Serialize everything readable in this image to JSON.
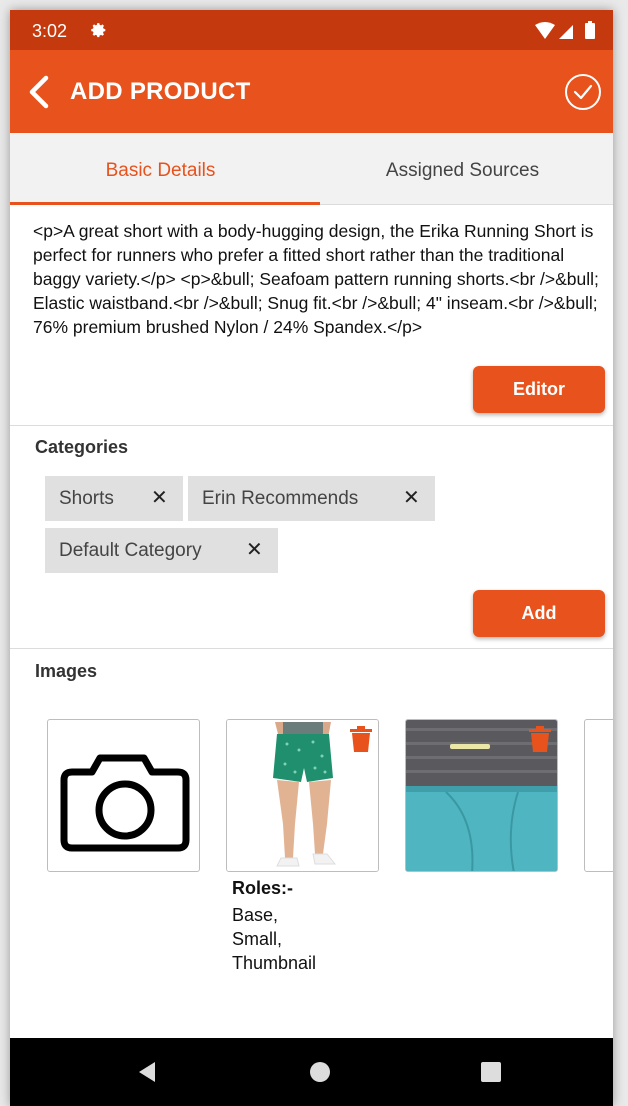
{
  "status_bar": {
    "time": "3:02"
  },
  "app_bar": {
    "title": "ADD PRODUCT"
  },
  "tabs": [
    {
      "label": "Basic Details",
      "active": true
    },
    {
      "label": "Assigned Sources",
      "active": false
    }
  ],
  "description": {
    "text": "<p>A great short with a body-hugging design, the Erika Running Short is perfect for runners who prefer a fitted short rather than the traditional baggy variety.</p>\n<p>&bull; Seafoam pattern running shorts.<br />&bull; Elastic waistband.<br />&bull; Snug fit.<br />&bull; 4\" inseam.<br />&bull; 76% premium brushed Nylon / 24% Spandex.</p>",
    "editor_button": "Editor"
  },
  "categories": {
    "title": "Categories",
    "chips": [
      "Shorts",
      "Erin Recommends",
      "Default Category"
    ],
    "remove_glyph": "✕",
    "add_button": "Add"
  },
  "images": {
    "title": "Images",
    "roles_title": "Roles:-",
    "roles": [
      "Base,",
      "Small,",
      "Thumbnail"
    ]
  },
  "colors": {
    "status_bar": "#c4390d",
    "app_bar": "#e8521c",
    "accent": "#e8521c",
    "chip_bg": "#e0e0e0",
    "nav_bar": "#000000"
  }
}
